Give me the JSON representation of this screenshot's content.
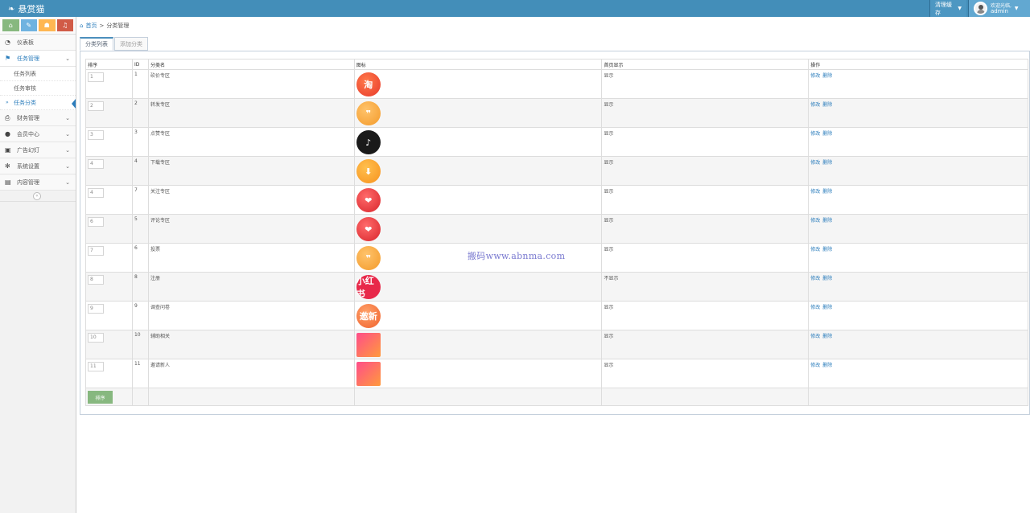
{
  "app": {
    "brand": "悬赏猫"
  },
  "navbar": {
    "clear_cache": "清理缓存",
    "welcome": "欢迎光临,",
    "username": "admin"
  },
  "colors": {
    "navbar": "#438eb9",
    "accent": "#2b7dbc",
    "sort_button": "#87b87f"
  },
  "sidebar": {
    "shortcuts": [
      {
        "icon": "home-icon",
        "color": "#87b87f"
      },
      {
        "icon": "pencil-icon",
        "color": "#6fb3e0"
      },
      {
        "icon": "users-icon",
        "color": "#ffb752"
      },
      {
        "icon": "bell-icon",
        "color": "#d15b47"
      }
    ],
    "menu": [
      {
        "label": "仪表板"
      },
      {
        "label": "任务管理"
      },
      {
        "label": "任务列表"
      },
      {
        "label": "任务审核"
      },
      {
        "label": "任务分类"
      },
      {
        "label": "财务管理"
      },
      {
        "label": "会员中心"
      },
      {
        "label": "广告幻灯"
      },
      {
        "label": "系统设置"
      },
      {
        "label": "内容管理"
      }
    ]
  },
  "breadcrumb": {
    "home": "首页",
    "separator": ">",
    "current": "分类管理"
  },
  "tabs": [
    {
      "label": "分类列表"
    },
    {
      "label": "添加分类"
    }
  ],
  "table": {
    "headers": [
      "排序",
      "ID",
      "分类名",
      "图标",
      "首页显示",
      "操作"
    ],
    "rows": [
      {
        "sort": "1",
        "id": "1",
        "name": "砍价专区",
        "icon": "taobao-icon",
        "icon_text": "淘",
        "show": "显示"
      },
      {
        "sort": "2",
        "id": "2",
        "name": "转发专区",
        "icon": "wechat-icon",
        "icon_text": "",
        "show": "显示"
      },
      {
        "sort": "3",
        "id": "3",
        "name": "点赞专区",
        "icon": "tiktok-icon",
        "icon_text": "♪",
        "show": "显示"
      },
      {
        "sort": "4",
        "id": "4",
        "name": "下载专区",
        "icon": "download-app-icon",
        "icon_text": "",
        "show": "显示"
      },
      {
        "sort": "4",
        "id": "7",
        "name": "关注专区",
        "icon": "heart-dots-icon",
        "icon_text": "",
        "show": "显示"
      },
      {
        "sort": "6",
        "id": "5",
        "name": "评论专区",
        "icon": "heart-dots-icon",
        "icon_text": "",
        "show": "显示"
      },
      {
        "sort": "7",
        "id": "6",
        "name": "投票",
        "icon": "wechat-icon",
        "icon_text": "",
        "show": "显示"
      },
      {
        "sort": "8",
        "id": "8",
        "name": "注册",
        "icon": "xiaohongshu-icon",
        "icon_text": "小红书",
        "show": "不显示"
      },
      {
        "sort": "9",
        "id": "9",
        "name": "调查问卷",
        "icon": "invite-new-icon",
        "icon_text": "邀新",
        "show": "显示"
      },
      {
        "sort": "10",
        "id": "10",
        "name": "辅助相关",
        "icon": "promo-cat-icon",
        "icon_text": "",
        "show": "显示"
      },
      {
        "sort": "11",
        "id": "11",
        "name": "邀请新人",
        "icon": "promo-cat-icon",
        "icon_text": "",
        "show": "显示"
      }
    ],
    "edit_label": "修改",
    "delete_label": "删除",
    "sort_button": "排序"
  },
  "watermark": "搬码www.abnma.com"
}
